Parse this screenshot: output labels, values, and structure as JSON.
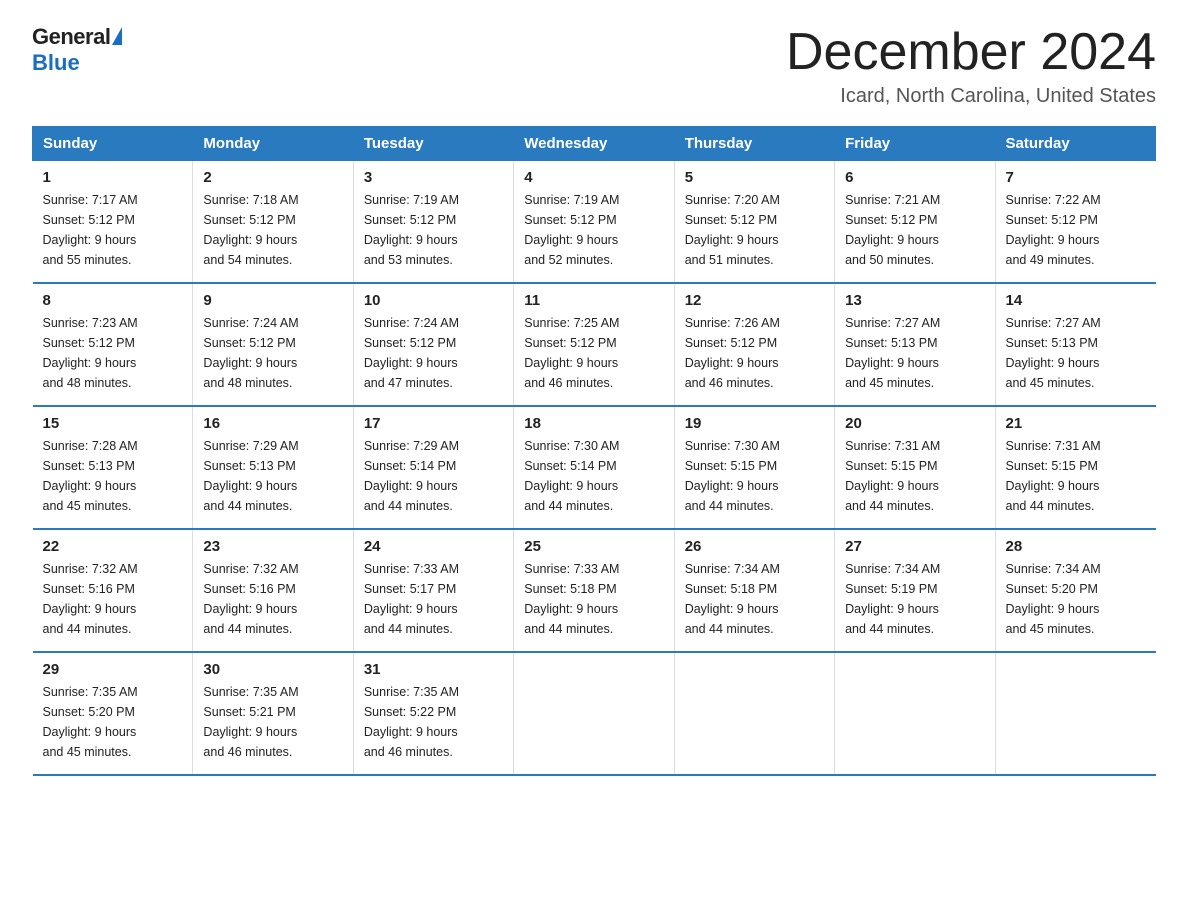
{
  "logo": {
    "general": "General",
    "blue": "Blue",
    "triangle": "▶"
  },
  "title": "December 2024",
  "subtitle": "Icard, North Carolina, United States",
  "days_of_week": [
    "Sunday",
    "Monday",
    "Tuesday",
    "Wednesday",
    "Thursday",
    "Friday",
    "Saturday"
  ],
  "weeks": [
    [
      {
        "day": "1",
        "sunrise": "7:17 AM",
        "sunset": "5:12 PM",
        "daylight": "9 hours and 55 minutes."
      },
      {
        "day": "2",
        "sunrise": "7:18 AM",
        "sunset": "5:12 PM",
        "daylight": "9 hours and 54 minutes."
      },
      {
        "day": "3",
        "sunrise": "7:19 AM",
        "sunset": "5:12 PM",
        "daylight": "9 hours and 53 minutes."
      },
      {
        "day": "4",
        "sunrise": "7:19 AM",
        "sunset": "5:12 PM",
        "daylight": "9 hours and 52 minutes."
      },
      {
        "day": "5",
        "sunrise": "7:20 AM",
        "sunset": "5:12 PM",
        "daylight": "9 hours and 51 minutes."
      },
      {
        "day": "6",
        "sunrise": "7:21 AM",
        "sunset": "5:12 PM",
        "daylight": "9 hours and 50 minutes."
      },
      {
        "day": "7",
        "sunrise": "7:22 AM",
        "sunset": "5:12 PM",
        "daylight": "9 hours and 49 minutes."
      }
    ],
    [
      {
        "day": "8",
        "sunrise": "7:23 AM",
        "sunset": "5:12 PM",
        "daylight": "9 hours and 48 minutes."
      },
      {
        "day": "9",
        "sunrise": "7:24 AM",
        "sunset": "5:12 PM",
        "daylight": "9 hours and 48 minutes."
      },
      {
        "day": "10",
        "sunrise": "7:24 AM",
        "sunset": "5:12 PM",
        "daylight": "9 hours and 47 minutes."
      },
      {
        "day": "11",
        "sunrise": "7:25 AM",
        "sunset": "5:12 PM",
        "daylight": "9 hours and 46 minutes."
      },
      {
        "day": "12",
        "sunrise": "7:26 AM",
        "sunset": "5:12 PM",
        "daylight": "9 hours and 46 minutes."
      },
      {
        "day": "13",
        "sunrise": "7:27 AM",
        "sunset": "5:13 PM",
        "daylight": "9 hours and 45 minutes."
      },
      {
        "day": "14",
        "sunrise": "7:27 AM",
        "sunset": "5:13 PM",
        "daylight": "9 hours and 45 minutes."
      }
    ],
    [
      {
        "day": "15",
        "sunrise": "7:28 AM",
        "sunset": "5:13 PM",
        "daylight": "9 hours and 45 minutes."
      },
      {
        "day": "16",
        "sunrise": "7:29 AM",
        "sunset": "5:13 PM",
        "daylight": "9 hours and 44 minutes."
      },
      {
        "day": "17",
        "sunrise": "7:29 AM",
        "sunset": "5:14 PM",
        "daylight": "9 hours and 44 minutes."
      },
      {
        "day": "18",
        "sunrise": "7:30 AM",
        "sunset": "5:14 PM",
        "daylight": "9 hours and 44 minutes."
      },
      {
        "day": "19",
        "sunrise": "7:30 AM",
        "sunset": "5:15 PM",
        "daylight": "9 hours and 44 minutes."
      },
      {
        "day": "20",
        "sunrise": "7:31 AM",
        "sunset": "5:15 PM",
        "daylight": "9 hours and 44 minutes."
      },
      {
        "day": "21",
        "sunrise": "7:31 AM",
        "sunset": "5:15 PM",
        "daylight": "9 hours and 44 minutes."
      }
    ],
    [
      {
        "day": "22",
        "sunrise": "7:32 AM",
        "sunset": "5:16 PM",
        "daylight": "9 hours and 44 minutes."
      },
      {
        "day": "23",
        "sunrise": "7:32 AM",
        "sunset": "5:16 PM",
        "daylight": "9 hours and 44 minutes."
      },
      {
        "day": "24",
        "sunrise": "7:33 AM",
        "sunset": "5:17 PM",
        "daylight": "9 hours and 44 minutes."
      },
      {
        "day": "25",
        "sunrise": "7:33 AM",
        "sunset": "5:18 PM",
        "daylight": "9 hours and 44 minutes."
      },
      {
        "day": "26",
        "sunrise": "7:34 AM",
        "sunset": "5:18 PM",
        "daylight": "9 hours and 44 minutes."
      },
      {
        "day": "27",
        "sunrise": "7:34 AM",
        "sunset": "5:19 PM",
        "daylight": "9 hours and 44 minutes."
      },
      {
        "day": "28",
        "sunrise": "7:34 AM",
        "sunset": "5:20 PM",
        "daylight": "9 hours and 45 minutes."
      }
    ],
    [
      {
        "day": "29",
        "sunrise": "7:35 AM",
        "sunset": "5:20 PM",
        "daylight": "9 hours and 45 minutes."
      },
      {
        "day": "30",
        "sunrise": "7:35 AM",
        "sunset": "5:21 PM",
        "daylight": "9 hours and 46 minutes."
      },
      {
        "day": "31",
        "sunrise": "7:35 AM",
        "sunset": "5:22 PM",
        "daylight": "9 hours and 46 minutes."
      },
      null,
      null,
      null,
      null
    ]
  ]
}
